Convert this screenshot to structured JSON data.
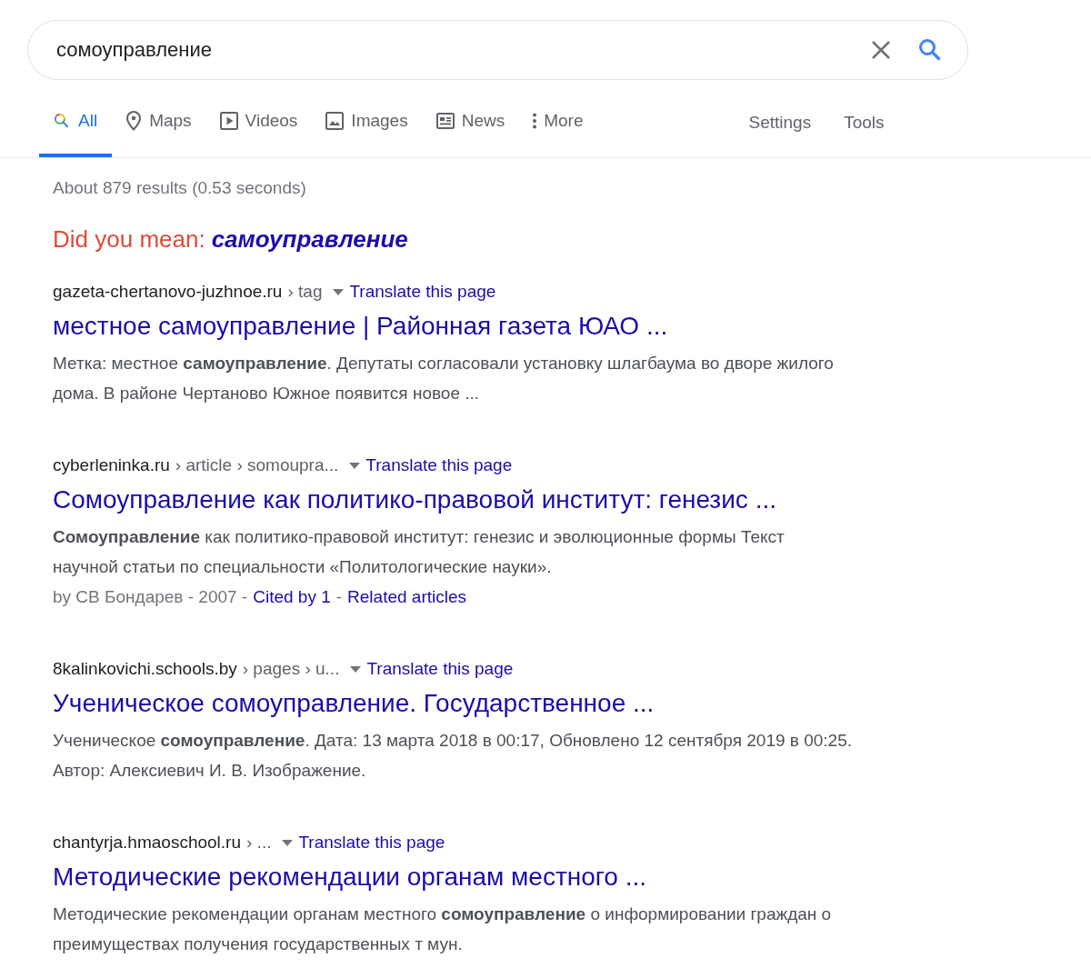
{
  "search": {
    "value": "сомоуправление"
  },
  "tabs": [
    {
      "label": "All",
      "selected": true
    },
    {
      "label": "Maps",
      "selected": false
    },
    {
      "label": "Videos",
      "selected": false
    },
    {
      "label": "Images",
      "selected": false
    },
    {
      "label": "News",
      "selected": false
    },
    {
      "label": "More",
      "selected": false
    }
  ],
  "tools": [
    "Settings",
    "Tools"
  ],
  "stats": "About 879 results (0.53 seconds)",
  "spelling": {
    "prompt": "Did you mean:",
    "suggestion": "самоуправление"
  },
  "results": [
    {
      "domain": "gazeta-chertanovo-juzhnoe.ru",
      "path": "› tag",
      "translate": "Translate this page",
      "title": "местное самоуправление | Районная газета ЮАО ...",
      "snippet": "Метка: местное **самоуправление**. Депутаты согласовали установку шлагбаума во дворе жилого дома. В районе Чертаново Южное появится новое ..."
    },
    {
      "domain": "cyberleninka.ru",
      "path": "› article › somoupra...",
      "translate": "Translate this page",
      "title": "Сомоуправление как политико-правовой институт: генезис ...",
      "snippet": "**Сомоуправление** как политико-правовой институт: генезис и эволюционные формы Текст научной статьи по специальности «Политологические науки».",
      "meta": [
        {
          "kind": "text",
          "text": "by СВ Бондарев - 2007 -"
        },
        {
          "kind": "link",
          "text": "Cited by 1"
        },
        {
          "kind": "text",
          "text": "-"
        },
        {
          "kind": "link",
          "text": "Related articles"
        }
      ]
    },
    {
      "domain": "8kalinkovichi.schools.by",
      "path": "› pages › u...",
      "translate": "Translate this page",
      "title": "Ученическое сомоуправление. Государственное ...",
      "snippet": "Ученическое **сомоуправление**. Дата: 13 марта 2018 в 00:17, Обновлено 12 сентября 2019 в 00:25. Автор: Алексиевич И. В. Изображение."
    },
    {
      "domain": "chantyrja.hmaoschool.ru",
      "path": "› ...",
      "translate": "Translate this page",
      "title": "Методические рекомендации органам местного ...",
      "snippet": "Методические рекомендации органам местного **сомоуправление** о информировании граждан о преимуществах получения государственных т мун."
    }
  ]
}
